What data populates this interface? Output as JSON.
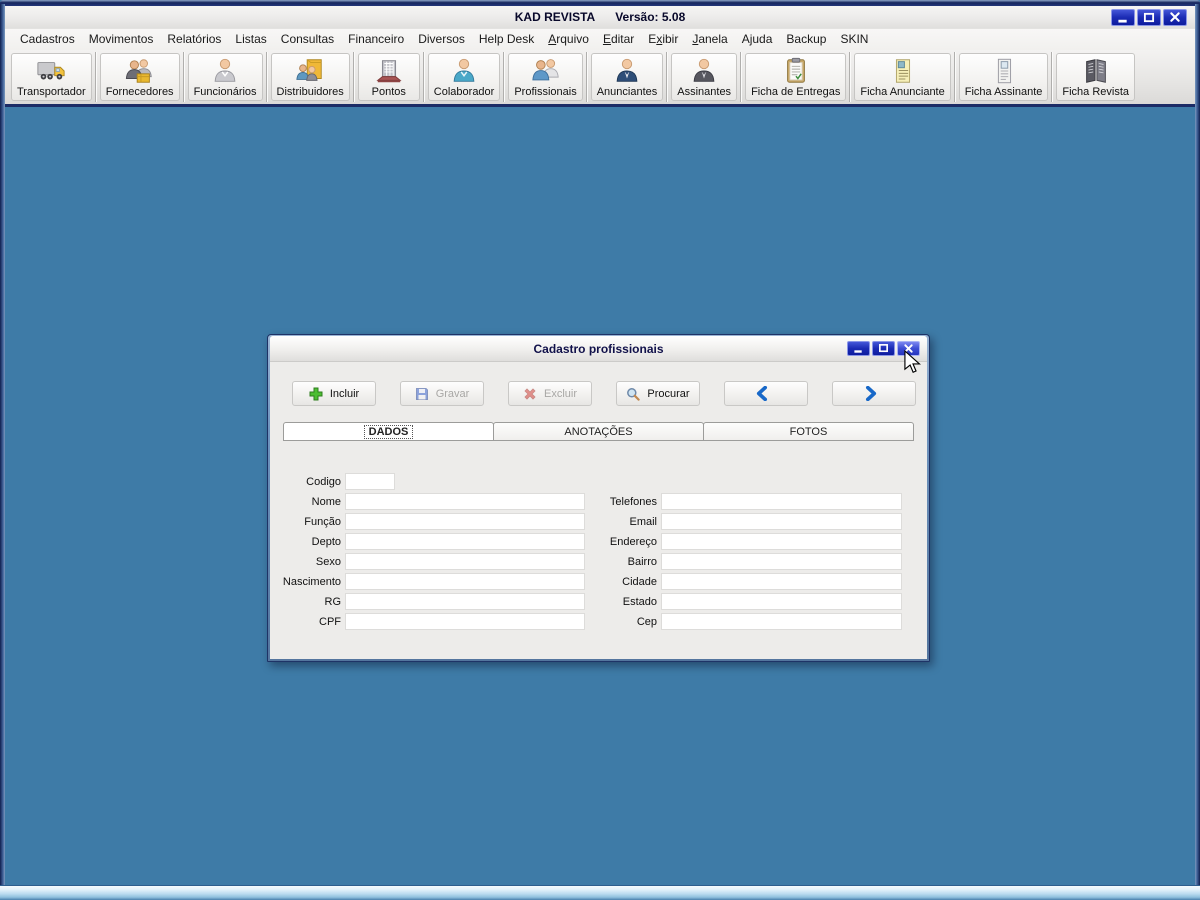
{
  "window": {
    "title": "KAD REVISTA",
    "version": "Versão: 5.08"
  },
  "menu": {
    "items": [
      {
        "id": "cadastros",
        "pre": "Cadastros",
        "u": "",
        "post": ""
      },
      {
        "id": "movimentos",
        "pre": "Movimentos",
        "u": "",
        "post": ""
      },
      {
        "id": "relatorios",
        "pre": "Relatórios",
        "u": "",
        "post": ""
      },
      {
        "id": "listas",
        "pre": "Listas",
        "u": "",
        "post": ""
      },
      {
        "id": "consultas",
        "pre": "Consultas",
        "u": "",
        "post": ""
      },
      {
        "id": "financeiro",
        "pre": "Financeiro",
        "u": "",
        "post": ""
      },
      {
        "id": "diversos",
        "pre": "Diversos",
        "u": "",
        "post": ""
      },
      {
        "id": "help-desk",
        "pre": "Help Desk",
        "u": "",
        "post": ""
      },
      {
        "id": "arquivo",
        "pre": "",
        "u": "A",
        "post": "rquivo"
      },
      {
        "id": "editar",
        "pre": "",
        "u": "E",
        "post": "ditar"
      },
      {
        "id": "exibir",
        "pre": "E",
        "u": "x",
        "post": "ibir"
      },
      {
        "id": "janela",
        "pre": "",
        "u": "J",
        "post": "anela"
      },
      {
        "id": "ajuda",
        "pre": "Ajuda",
        "u": "",
        "post": ""
      },
      {
        "id": "backup",
        "pre": "Backup",
        "u": "",
        "post": ""
      },
      {
        "id": "skin",
        "pre": "SKIN",
        "u": "",
        "post": ""
      }
    ]
  },
  "toolbar": {
    "buttons": [
      {
        "label": "Transportador",
        "icon": "truck"
      },
      {
        "label": "Fornecedores",
        "icon": "two-people-box"
      },
      {
        "label": "Funcionários",
        "icon": "person-gray"
      },
      {
        "label": "Distribuidores",
        "icon": "people-folder"
      },
      {
        "label": "Pontos",
        "icon": "building"
      },
      {
        "label": "Colaborador",
        "icon": "person-teal"
      },
      {
        "label": "Profissionais",
        "icon": "two-people"
      },
      {
        "label": "Anunciantes",
        "icon": "person-suit"
      },
      {
        "label": "Assinantes",
        "icon": "person-dark"
      },
      {
        "label": "Ficha de Entregas",
        "icon": "clipboard"
      },
      {
        "label": "Ficha Anunciante",
        "icon": "document-yellow"
      },
      {
        "label": "Ficha Assinante",
        "icon": "document-gray"
      },
      {
        "label": "Ficha Revista",
        "icon": "book"
      }
    ]
  },
  "dialog": {
    "title": "Cadastro profissionais",
    "actions": [
      {
        "label": "Incluir",
        "icon": "plus",
        "enabled": true
      },
      {
        "label": "Gravar",
        "icon": "save",
        "enabled": false
      },
      {
        "label": "Excluir",
        "icon": "delete",
        "enabled": false
      },
      {
        "label": "Procurar",
        "icon": "search",
        "enabled": true
      },
      {
        "label": "",
        "icon": "prev",
        "enabled": true
      },
      {
        "label": "",
        "icon": "next",
        "enabled": true
      }
    ],
    "tabs": [
      {
        "label": "DADOS",
        "active": true
      },
      {
        "label": "ANOTAÇÕES",
        "active": false
      },
      {
        "label": "FOTOS",
        "active": false
      }
    ],
    "form": {
      "left": [
        {
          "label": "Codigo",
          "value": ""
        },
        {
          "label": "Nome",
          "value": ""
        },
        {
          "label": "Função",
          "value": ""
        },
        {
          "label": "Depto",
          "value": ""
        },
        {
          "label": "Sexo",
          "value": ""
        },
        {
          "label": "Nascimento",
          "value": ""
        },
        {
          "label": "RG",
          "value": ""
        },
        {
          "label": "CPF",
          "value": ""
        }
      ],
      "right": [
        {
          "label": "Telefones",
          "value": ""
        },
        {
          "label": "Email",
          "value": ""
        },
        {
          "label": "Endereço",
          "value": ""
        },
        {
          "label": "Bairro",
          "value": ""
        },
        {
          "label": "Cidade",
          "value": ""
        },
        {
          "label": "Estado",
          "value": ""
        },
        {
          "label": "Cep",
          "value": ""
        }
      ]
    }
  },
  "colors": {
    "mdi_background": "#3E7BA7",
    "control_button_blue": "#1B2BB4",
    "arrow_blue": "#1868C8",
    "plus_green": "#3FAE2A",
    "delete_red": "#D03028"
  }
}
